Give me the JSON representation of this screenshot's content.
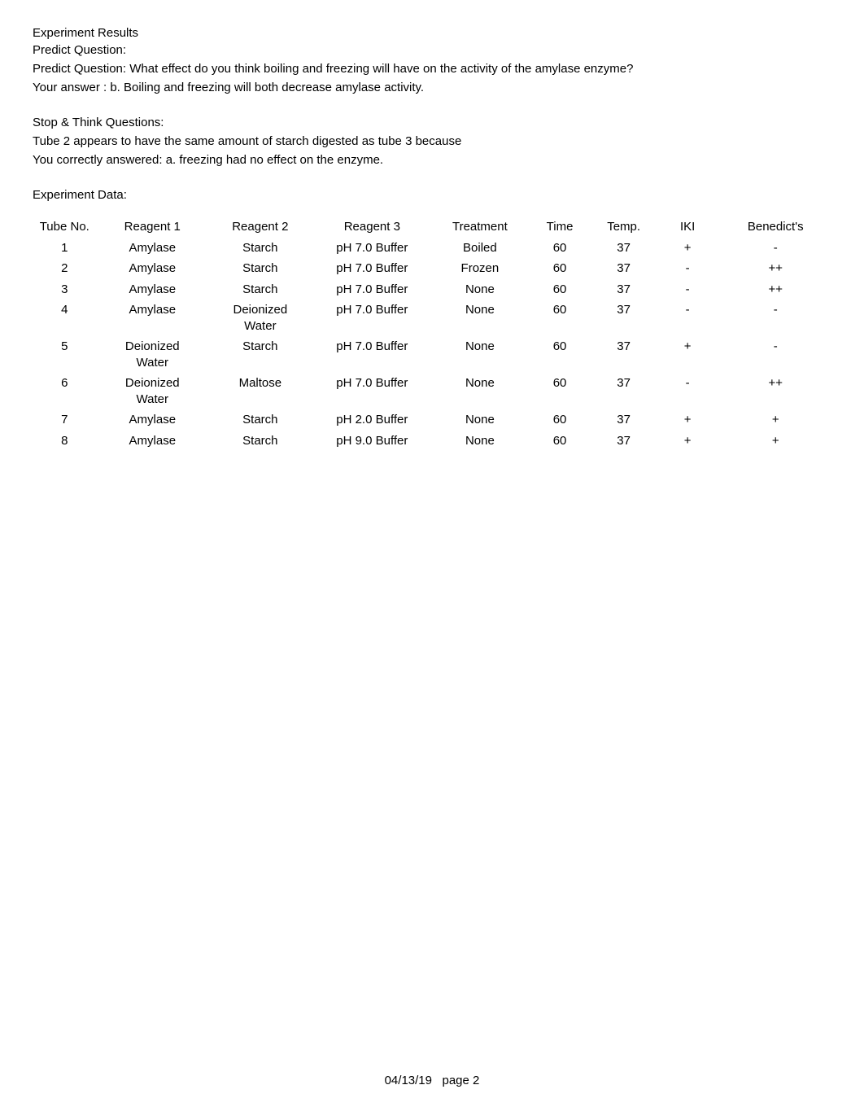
{
  "headings": {
    "experiment_results": "Experiment Results",
    "predict_question_label": "Predict Question:",
    "predict_question_text": "Predict Question:  What effect do you think boiling and freezing will have on the activity of the amylase enzyme?",
    "your_answer": "Your answer : b. Boiling and freezing will both decrease amylase activity.",
    "stop_think": "Stop & Think Questions:",
    "stop_think_q": "Tube 2 appears to have the same amount of starch digested as tube 3 because",
    "stop_think_a": "You correctly answered: a. freezing had no effect on the enzyme.",
    "experiment_data": "Experiment Data:"
  },
  "table": {
    "headers": {
      "tube_no": "Tube No.",
      "reagent1": "Reagent 1",
      "reagent2": "Reagent 2",
      "reagent3": "Reagent 3",
      "treatment": "Treatment",
      "time": "Time",
      "temp": "Temp.",
      "iki": "IKI",
      "benedicts": "Benedict's"
    },
    "rows": [
      {
        "tube": "1",
        "r1": "Amylase",
        "r2": "Starch",
        "r3": "pH 7.0 Buffer",
        "treat": "Boiled",
        "time": "60",
        "temp": "37",
        "iki": "+",
        "ben": "-"
      },
      {
        "tube": "2",
        "r1": "Amylase",
        "r2": "Starch",
        "r3": "pH 7.0 Buffer",
        "treat": "Frozen",
        "time": "60",
        "temp": "37",
        "iki": "-",
        "ben": "++"
      },
      {
        "tube": "3",
        "r1": "Amylase",
        "r2": "Starch",
        "r3": "pH 7.0 Buffer",
        "treat": "None",
        "time": "60",
        "temp": "37",
        "iki": "-",
        "ben": "++"
      },
      {
        "tube": "4",
        "r1": "Amylase",
        "r2": "Deionized Water",
        "r3": "pH 7.0 Buffer",
        "treat": "None",
        "time": "60",
        "temp": "37",
        "iki": "-",
        "ben": "-"
      },
      {
        "tube": "5",
        "r1": "Deionized Water",
        "r2": "Starch",
        "r3": "pH 7.0 Buffer",
        "treat": "None",
        "time": "60",
        "temp": "37",
        "iki": "+",
        "ben": "-"
      },
      {
        "tube": "6",
        "r1": "Deionized Water",
        "r2": "Maltose",
        "r3": "pH 7.0 Buffer",
        "treat": "None",
        "time": "60",
        "temp": "37",
        "iki": "-",
        "ben": "++"
      },
      {
        "tube": "7",
        "r1": "Amylase",
        "r2": "Starch",
        "r3": "pH 2.0 Buffer",
        "treat": "None",
        "time": "60",
        "temp": "37",
        "iki": "+",
        "ben": "+"
      },
      {
        "tube": "8",
        "r1": "Amylase",
        "r2": "Starch",
        "r3": "pH 9.0 Buffer",
        "treat": "None",
        "time": "60",
        "temp": "37",
        "iki": "+",
        "ben": "+"
      }
    ]
  },
  "footer": {
    "date": "04/13/19",
    "page": "page 2"
  }
}
